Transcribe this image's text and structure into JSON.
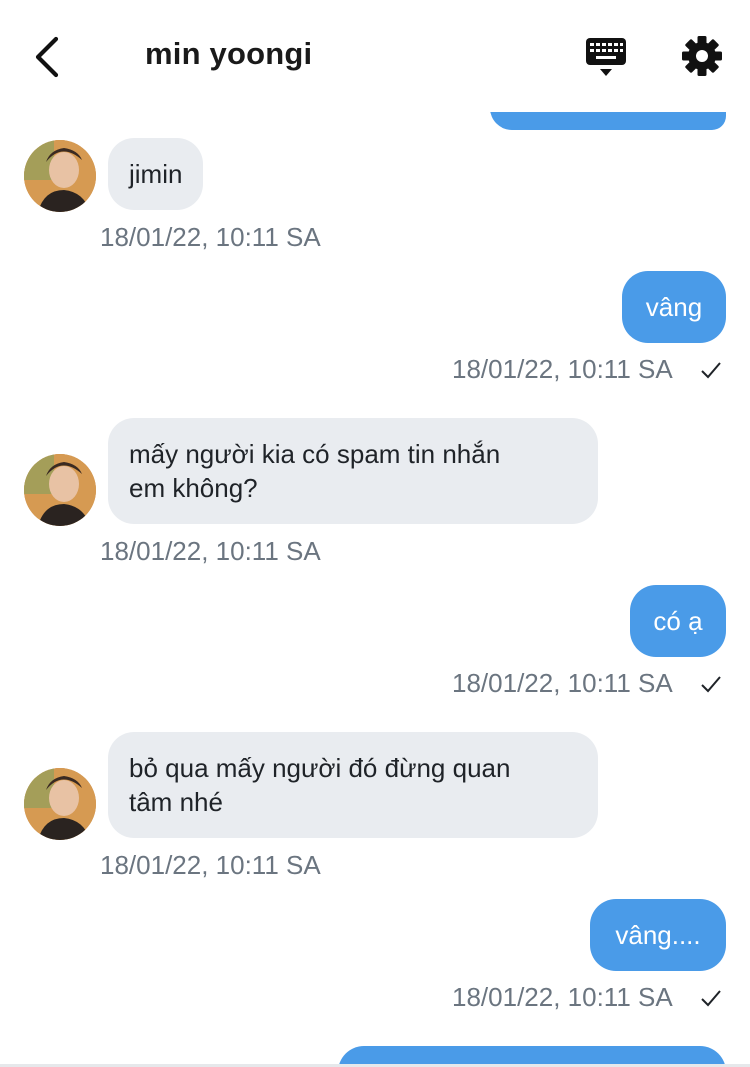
{
  "header": {
    "title": "min yoongi",
    "back_icon": "chevron-left-icon",
    "keyboard_icon": "keyboard-icon",
    "settings_icon": "gear-icon"
  },
  "colors": {
    "sent_bubble": "#4a9be8",
    "received_bubble": "#e9ecf0",
    "timestamp": "#6b7580"
  },
  "messages": [
    {
      "direction": "received",
      "text": "jimin",
      "timestamp": "18/01/22, 10:11 SA"
    },
    {
      "direction": "sent",
      "text": "vâng",
      "timestamp": "18/01/22, 10:11 SA",
      "read": true
    },
    {
      "direction": "received",
      "text": "mấy người kia có spam tin nhắn em không?",
      "line1": "mấy người kia có spam tin nhắn",
      "line2": "em không?",
      "timestamp": "18/01/22, 10:11 SA"
    },
    {
      "direction": "sent",
      "text": "có ạ",
      "timestamp": "18/01/22, 10:11 SA",
      "read": true
    },
    {
      "direction": "received",
      "text": "bỏ qua mấy người đó đừng quan tâm nhé",
      "line1": "bỏ qua mấy người đó đừng quan",
      "line2": "tâm nhé",
      "timestamp": "18/01/22, 10:11 SA"
    },
    {
      "direction": "sent",
      "text": "vâng....",
      "timestamp": "18/01/22, 10:11 SA",
      "read": true
    }
  ]
}
